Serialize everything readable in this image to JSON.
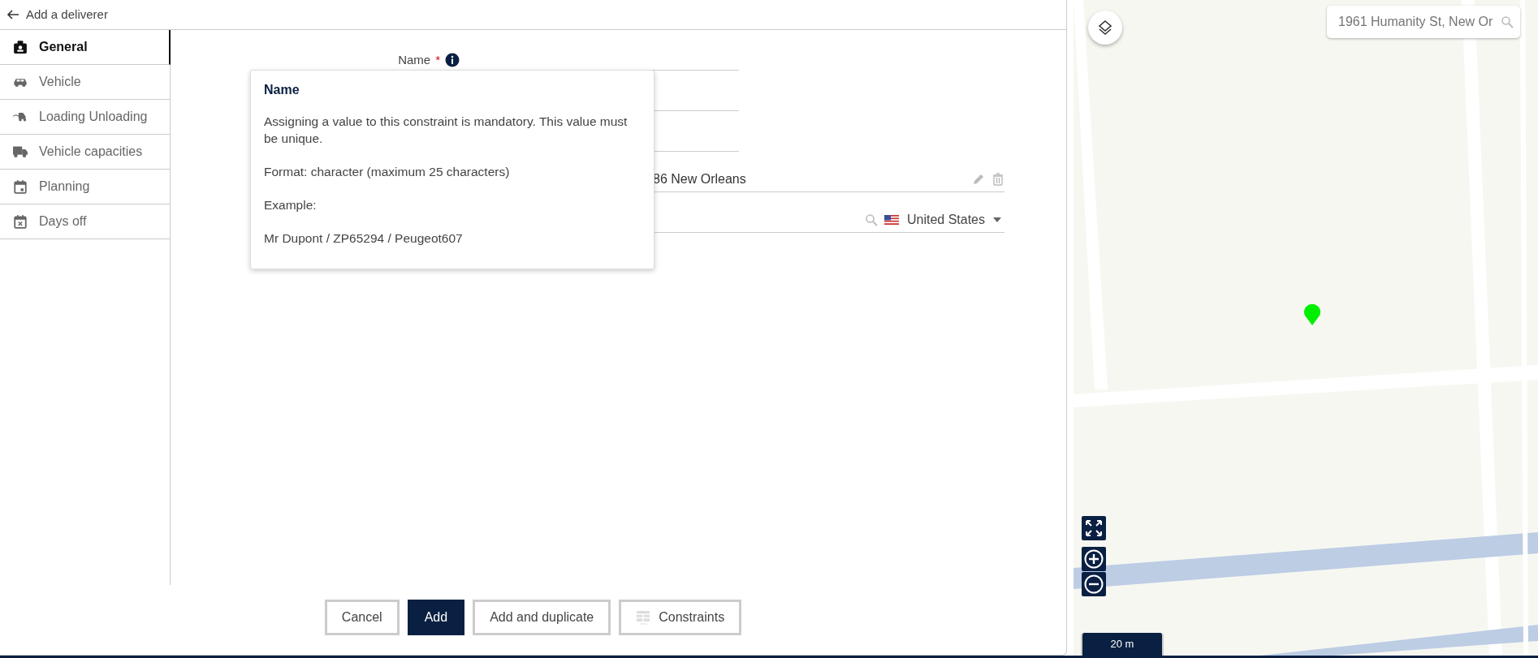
{
  "header": {
    "title": "Add a deliverer"
  },
  "sidebar": {
    "items": [
      {
        "label": "General",
        "selected": true
      },
      {
        "label": "Vehicle",
        "selected": false
      },
      {
        "label": "Loading Unloading",
        "selected": false
      },
      {
        "label": "Vehicle capacities",
        "selected": false
      },
      {
        "label": "Planning",
        "selected": false
      },
      {
        "label": "Days off",
        "selected": false
      }
    ]
  },
  "form": {
    "fields": [
      {
        "kind": "text",
        "label": "Name",
        "required_mark": "*"
      },
      {
        "kind": "text"
      },
      {
        "kind": "text"
      },
      {
        "kind": "address",
        "value": "86 New Orleans"
      },
      {
        "kind": "country",
        "value": "United States"
      }
    ]
  },
  "tooltip": {
    "title": "Name",
    "paragraphs": [
      "Assigning a value to this constraint is mandatory. This value must be unique.",
      "Format: character (maximum 25 characters)",
      "Example:",
      "Mr Dupont / ZP65294 / Peugeot607"
    ]
  },
  "buttons": [
    {
      "label": "Cancel",
      "kind": "secondary"
    },
    {
      "label": "Add",
      "kind": "primary"
    },
    {
      "label": "Add and duplicate",
      "kind": "secondary"
    },
    {
      "label": "Constraints",
      "kind": "constraints"
    }
  ],
  "map": {
    "search": {
      "placeholder": "1961 Humanity St, New Or"
    },
    "scale": "20 m"
  }
}
